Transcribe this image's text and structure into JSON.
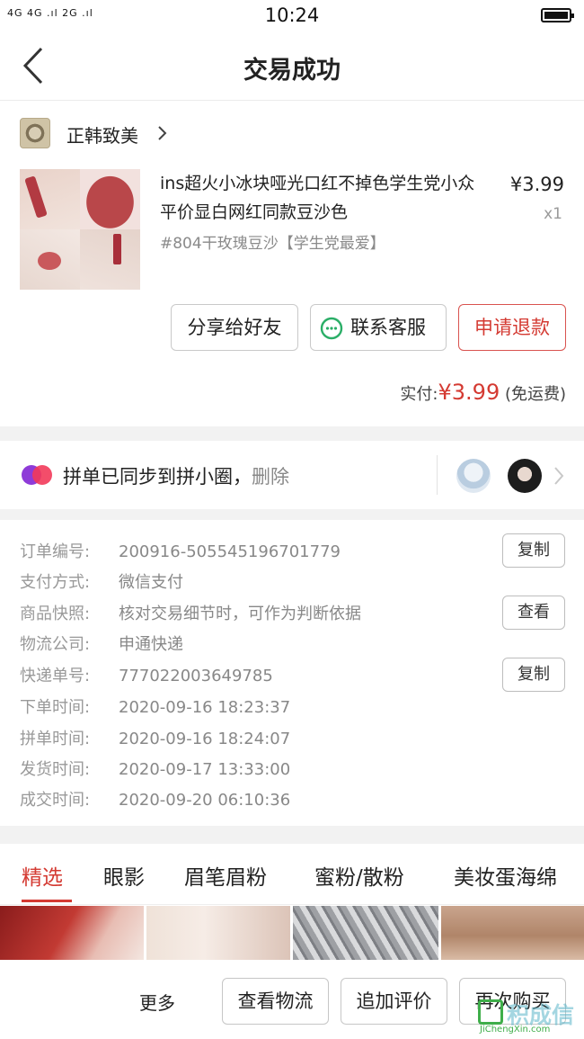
{
  "status_bar": {
    "signal_text": "4G 4G .ıl 2G .ıl",
    "time": "10:24"
  },
  "header": {
    "title": "交易成功"
  },
  "store": {
    "name": "正韩致美"
  },
  "product": {
    "title": "ins超火小冰块哑光口红不掉色学生党小众平价显白网红同款豆沙色",
    "sku": "#804干玫瑰豆沙【学生党最爱】",
    "price": "¥3.99",
    "quantity": "x1"
  },
  "actions": {
    "share": "分享给好友",
    "contact": "联系客服",
    "refund": "申请退款"
  },
  "payment": {
    "label": "实付:",
    "currency": "¥",
    "amount": "3.99",
    "note": "(免运费)"
  },
  "pindan": {
    "text": "拼单已同步到拼小圈，",
    "delete": "删除"
  },
  "order_details": [
    {
      "key": "订单编号:",
      "value": "200916-505545196701779",
      "button": "复制"
    },
    {
      "key": "支付方式:",
      "value": "微信支付"
    },
    {
      "key": "商品快照:",
      "value": "核对交易细节时，可作为判断依据",
      "button": "查看"
    },
    {
      "key": "物流公司:",
      "value": "申通快递"
    },
    {
      "key": "快递单号:",
      "value": "777022003649785",
      "button": "复制"
    },
    {
      "key": "下单时间:",
      "value": "2020-09-16 18:23:37"
    },
    {
      "key": "拼单时间:",
      "value": "2020-09-16 18:24:07"
    },
    {
      "key": "发货时间:",
      "value": "2020-09-17 13:33:00"
    },
    {
      "key": "成交时间:",
      "value": "2020-09-20 06:10:36"
    }
  ],
  "tabs": [
    "精选",
    "眼影",
    "眉笔眉粉",
    "蜜粉/散粉",
    "美妆蛋海绵"
  ],
  "bottom_bar": {
    "more": "更多",
    "track": "查看物流",
    "review": "追加评价",
    "rebuy": "再次购买"
  },
  "watermark": {
    "main": "积成信",
    "url": "JiChengXin.com"
  },
  "colors": {
    "accent": "#d43a32",
    "muted": "#999999",
    "wechat_green": "#2aae67"
  }
}
